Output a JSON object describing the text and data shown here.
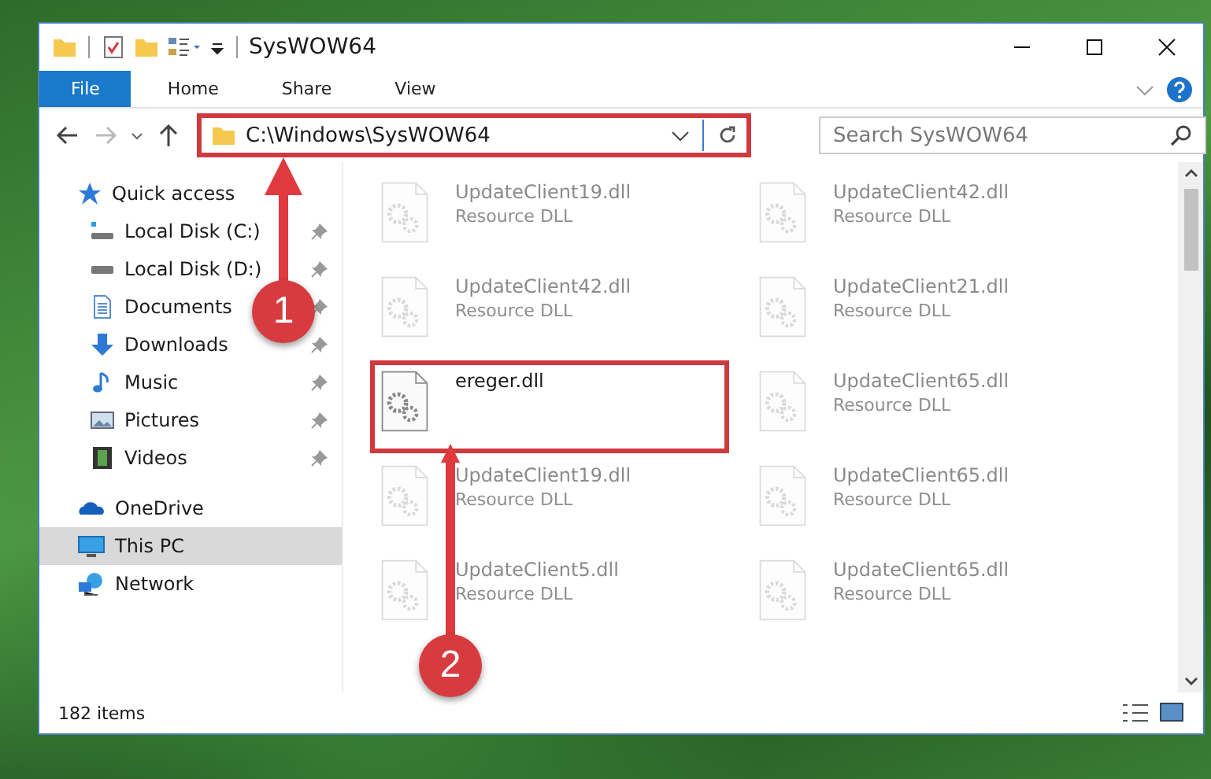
{
  "window": {
    "title": "SysWOW64"
  },
  "ribbon_tabs": [
    {
      "label": "File",
      "kind": "file",
      "selected": false
    },
    {
      "label": "Home",
      "kind": "tab",
      "selected": false
    },
    {
      "label": "Share",
      "kind": "tab",
      "selected": false
    },
    {
      "label": "View",
      "kind": "tab",
      "selected": false
    }
  ],
  "address_bar": {
    "path": "C:\\Windows\\SysWOW64",
    "highlighted": true
  },
  "search": {
    "placeholder": "Search SysWOW64"
  },
  "navigation": [
    {
      "label": "Quick access",
      "kind": "star",
      "selected": false,
      "children": [
        {
          "label": "Local Disk (C:)",
          "kind": "system-drive",
          "pinned": true
        },
        {
          "label": "Local Disk (D:)",
          "kind": "drive",
          "pinned": true
        },
        {
          "label": "Documents",
          "kind": "document",
          "pinned": true
        },
        {
          "label": "Downloads",
          "kind": "download",
          "pinned": true
        },
        {
          "label": "Music",
          "kind": "music",
          "pinned": true
        },
        {
          "label": "Pictures",
          "kind": "picture",
          "pinned": true
        },
        {
          "label": "Videos",
          "kind": "video",
          "pinned": true
        }
      ]
    },
    {
      "label": "OneDrive",
      "kind": "cloud",
      "selected": false
    },
    {
      "label": "This PC",
      "kind": "computer",
      "selected": true
    },
    {
      "label": "Network",
      "kind": "network",
      "selected": false
    }
  ],
  "files": [
    {
      "name": "UpdateClient19.dll",
      "type": "Resource DLL",
      "faded": true,
      "highlighted": false
    },
    {
      "name": "UpdateClient42.dll",
      "type": "Resource DLL",
      "faded": true,
      "highlighted": false
    },
    {
      "name": "UpdateClient42.dll",
      "type": "Resource DLL",
      "faded": true,
      "highlighted": false
    },
    {
      "name": "UpdateClient21.dll",
      "type": "Resource DLL",
      "faded": true,
      "highlighted": false
    },
    {
      "name": "ereger.dll",
      "faded": false,
      "highlighted": true
    },
    {
      "name": "UpdateClient65.dll",
      "type": "Resource DLL",
      "faded": true,
      "highlighted": false
    },
    {
      "name": "UpdateClient19.dll",
      "type": "Resource DLL",
      "faded": true,
      "highlighted": false
    },
    {
      "name": "UpdateClient65.dll",
      "type": "Resource DLL",
      "faded": true,
      "highlighted": false
    },
    {
      "name": "UpdateClient5.dll",
      "type": "Resource DLL",
      "faded": true,
      "highlighted": false
    },
    {
      "name": "UpdateClient65.dll",
      "type": "Resource DLL",
      "faded": true,
      "highlighted": false
    }
  ],
  "status_bar": {
    "item_count": "182 items"
  },
  "callouts": [
    {
      "number": "1"
    },
    {
      "number": "2"
    }
  ]
}
